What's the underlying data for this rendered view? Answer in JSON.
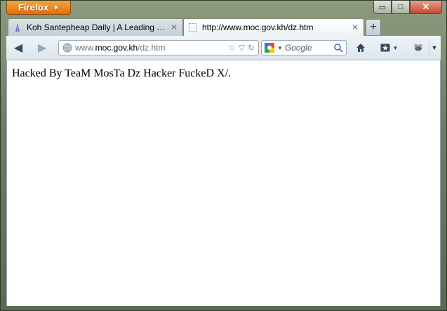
{
  "titlebar": {
    "app_button_label": "Firefox",
    "controls": {
      "minimize": "▭",
      "maximize": "□",
      "close": "✕"
    }
  },
  "tabs": [
    {
      "label": "Koh Santepheap Daily | A Leading Ne...",
      "favicon": "koh-santepheap-favicon",
      "active": false,
      "close": "✕"
    },
    {
      "label": "http://www.moc.gov.kh/dz.htm",
      "favicon": "blank-page-favicon",
      "active": true,
      "close": "✕"
    }
  ],
  "new_tab_label": "+",
  "navbar": {
    "back": "back-arrow-icon",
    "forward": "forward-arrow-icon",
    "url": {
      "scheme": "www.",
      "host": "moc.gov.kh",
      "path": "/dz.htm"
    },
    "search": {
      "placeholder": "Google",
      "engine": "google-icon"
    },
    "home": "home-icon",
    "bookmarks": "bookmarks-icon",
    "addon": "addon-icon"
  },
  "content": {
    "text": "Hacked By TeaM MosTa Dz Hacker FuckeD X/."
  },
  "colors": {
    "firefox_button": "#e2700d",
    "close_button": "#c7472f",
    "chrome_glass": "#6e7d62"
  }
}
